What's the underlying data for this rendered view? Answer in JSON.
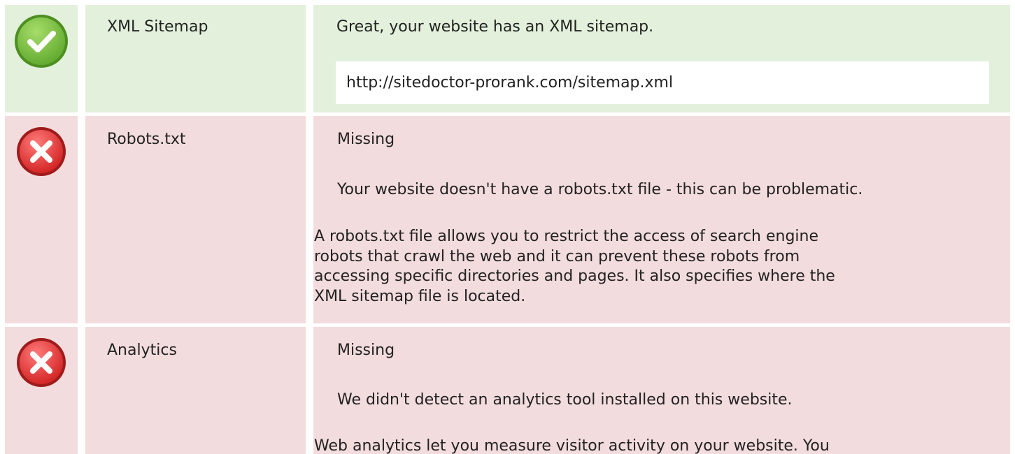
{
  "rows": [
    {
      "status": "pass",
      "icon": "check-circle-icon",
      "label": "XML Sitemap",
      "message": "Great, your website has an XML sitemap.",
      "url": "http://sitedoctor-prorank.com/sitemap.xml"
    },
    {
      "status": "fail",
      "icon": "error-x-circle-icon",
      "label": "Robots.txt",
      "status_text": "Missing",
      "message": "Your website doesn't have a robots.txt file - this can be problematic.",
      "description_lines": [
        "A robots.txt file allows you to restrict the access of search engine",
        "robots that crawl the web and it can prevent these robots from",
        "accessing specific directories and pages. It also specifies where the",
        "XML sitemap file is located."
      ]
    },
    {
      "status": "fail",
      "icon": "error-x-circle-icon",
      "label": "Analytics",
      "status_text": "Missing",
      "message": "We didn't detect an analytics tool installed on this website.",
      "description_lines": [
        "Web analytics let you measure visitor activity on your website. You"
      ]
    }
  ],
  "colors": {
    "pass_bg": "#e3f1dc",
    "fail_bg": "#f3dcdd",
    "pass_icon": "#7cc242",
    "fail_icon": "#e23b3b"
  }
}
